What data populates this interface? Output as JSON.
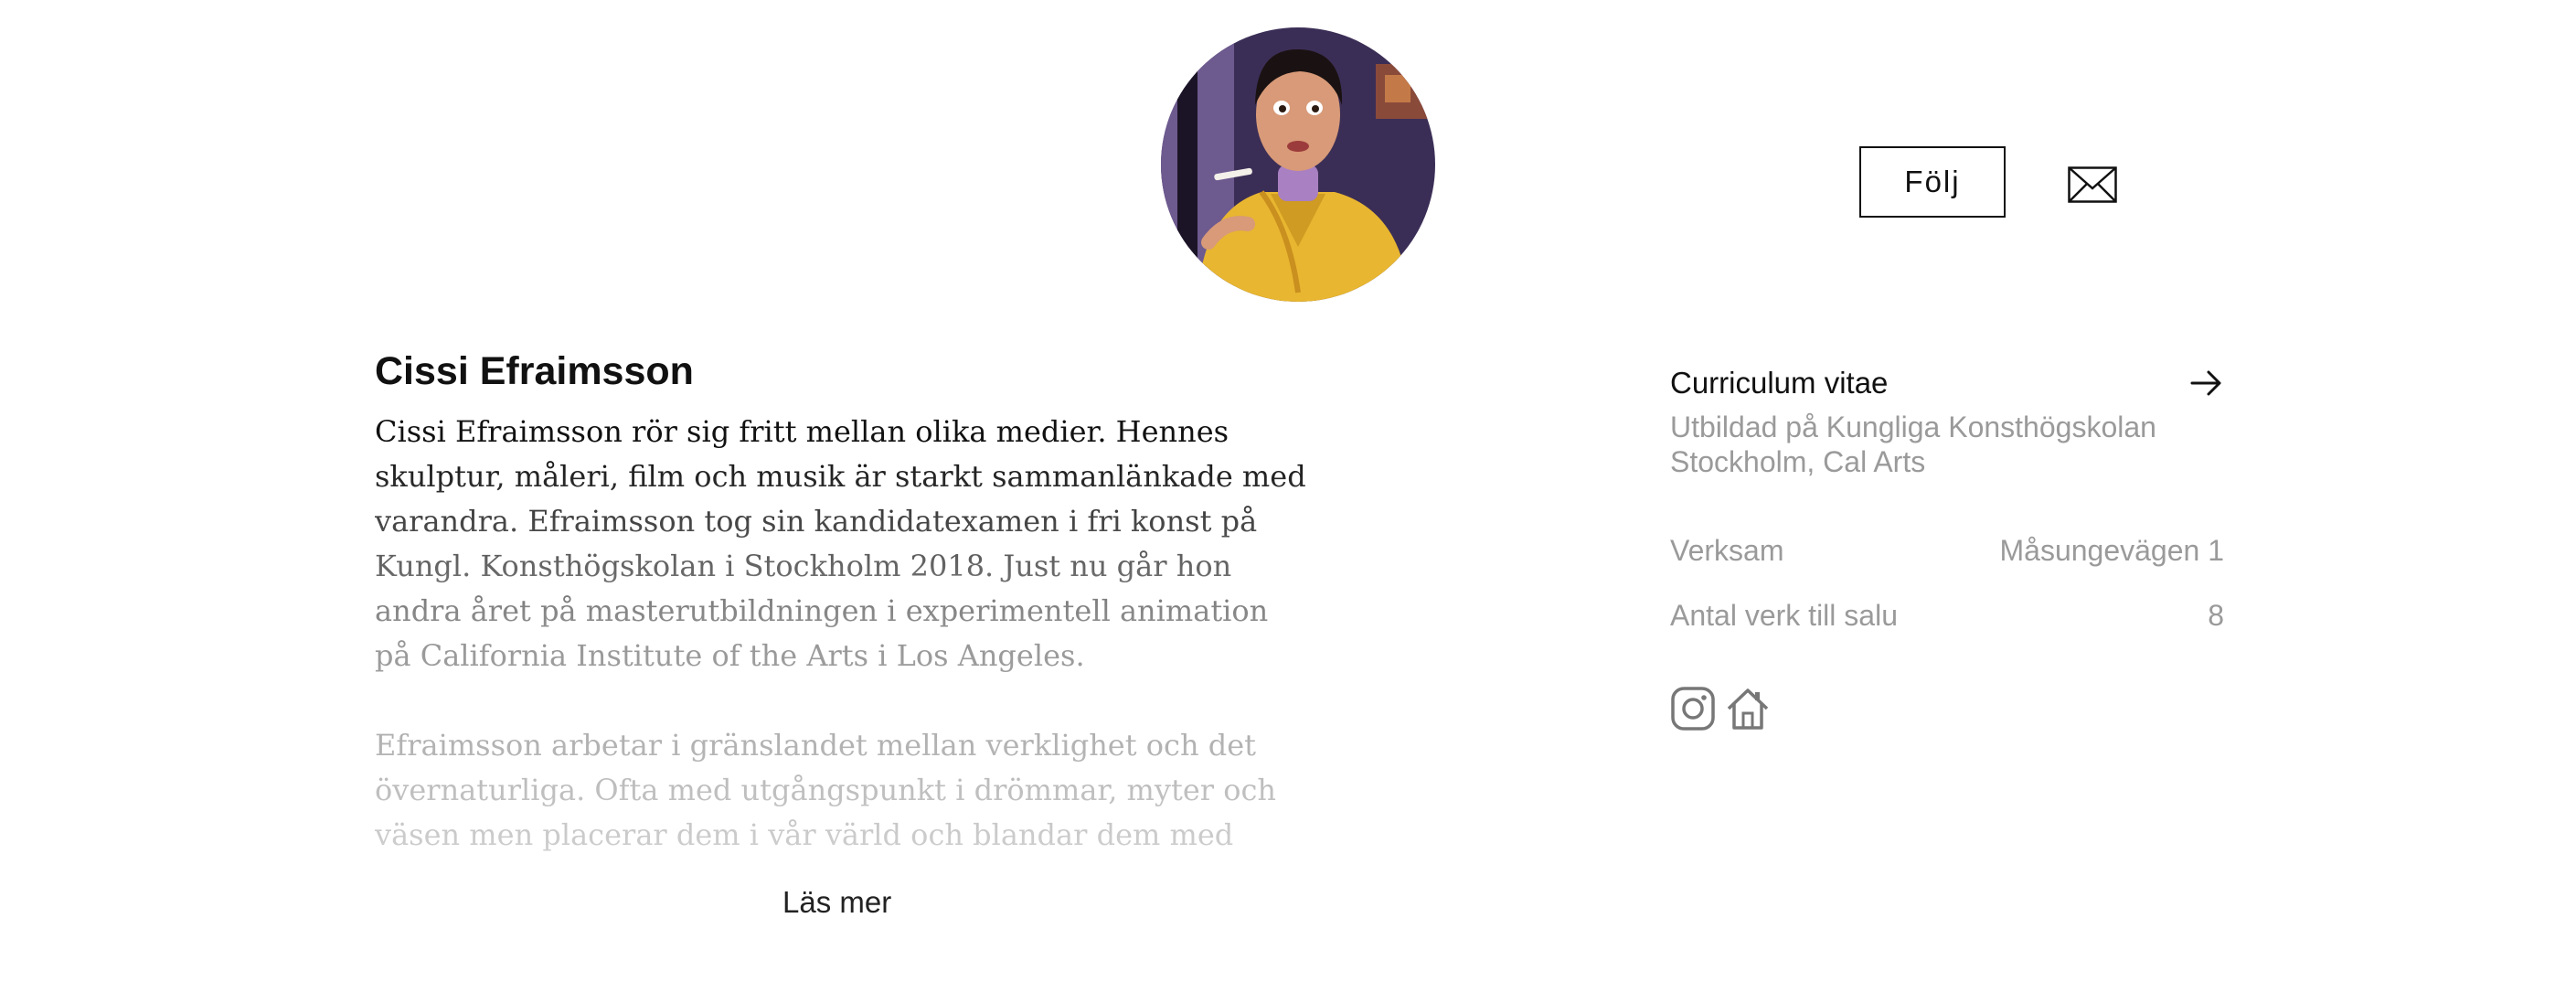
{
  "profile": {
    "name": "Cissi Efraimsson",
    "follow_label": "Följ",
    "bio_paragraphs": [
      "Cissi Efraimsson rör sig fritt mellan olika medier. Hennes skulptur, måleri, film och musik är starkt sammanlänkade med varandra. Efraimsson tog sin kandidatexamen i fri konst på Kungl. Konsthögskolan i Stockholm 2018. Just nu går hon andra året på masterutbildningen i experimentell animation på California Institute of the Arts i Los Angeles.",
      "Efraimsson arbetar i gränslandet mellan verklighet och det övernaturliga. Ofta med utgångspunkt i drömmar, myter och väsen men placerar dem i vår värld och blandar dem med nutid."
    ],
    "read_more_label": "Läs mer"
  },
  "sidebar": {
    "cv_title": "Curriculum vitae",
    "cv_description": "Utbildad på Kungliga Konsthögskolan Stockholm, Cal Arts",
    "rows": [
      {
        "label": "Verksam",
        "value": "Måsungevägen 1"
      },
      {
        "label": "Antal verk till salu",
        "value": "8"
      }
    ]
  },
  "icons": {
    "mail": "mail-icon",
    "cv_arrow": "arrow-right-icon",
    "instagram": "instagram-icon",
    "home": "home-icon"
  },
  "colors": {
    "text": "#111111",
    "muted": "#9a9a9a",
    "avatar_coat": "#e8b630",
    "avatar_background": "#3b2e56"
  }
}
